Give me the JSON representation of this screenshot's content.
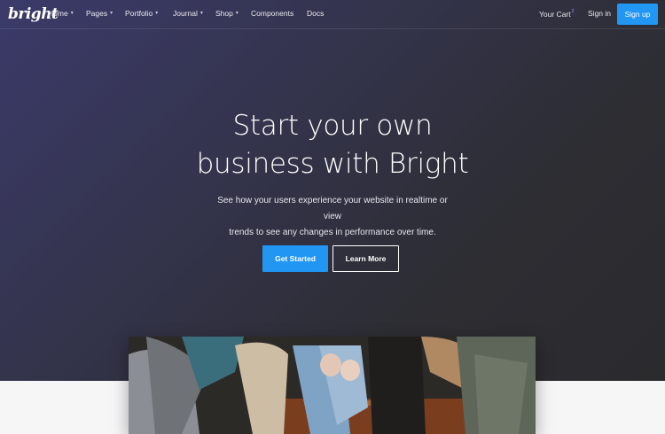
{
  "brand": {
    "logo_text": "bright"
  },
  "nav": {
    "items": [
      {
        "label": "Home",
        "has_dropdown": true
      },
      {
        "label": "Pages",
        "has_dropdown": true
      },
      {
        "label": "Portfolio",
        "has_dropdown": true
      },
      {
        "label": "Journal",
        "has_dropdown": true
      },
      {
        "label": "Shop",
        "has_dropdown": true
      },
      {
        "label": "Components",
        "has_dropdown": false
      },
      {
        "label": "Docs",
        "has_dropdown": false
      }
    ],
    "cart_label": "Your Cart",
    "cart_count": "2",
    "signin_label": "Sign in",
    "signup_label": "Sign up"
  },
  "hero": {
    "headline_line1": "Start your own",
    "headline_line2": "business with Bright",
    "subtitle_line1": "See how your users experience your website in realtime or view",
    "subtitle_line2": "trends to see any changes in performance over time.",
    "primary_button": "Get Started",
    "secondary_button": "Learn More"
  },
  "colors": {
    "accent": "#2196f3",
    "hero_start": "#3b3a6a",
    "hero_end": "#2b2b2e",
    "page_bg": "#f6f6f7"
  },
  "icons": {
    "dropdown": "caret-down-icon"
  }
}
